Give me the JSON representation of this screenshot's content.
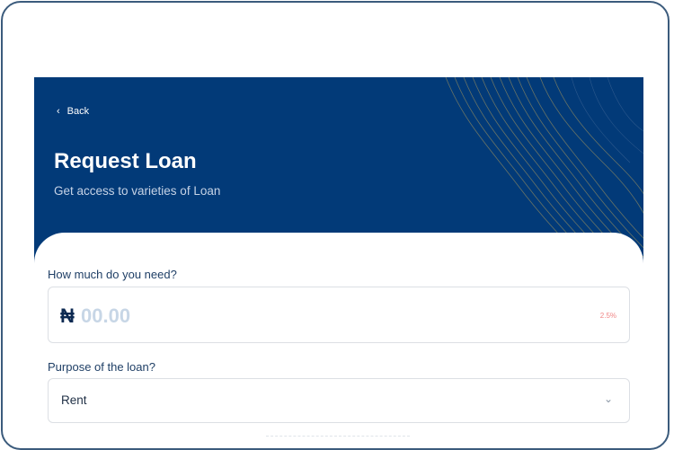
{
  "header": {
    "back_label": "Back",
    "title": "Request Loan",
    "subtitle": "Get access to varieties of Loan",
    "bg_color": "#023a78"
  },
  "form": {
    "amount_label": "How much do you need?",
    "currency_symbol": "₦",
    "amount_placeholder": "00.00",
    "rate": "2.5%",
    "purpose_label": "Purpose of the loan?",
    "purpose_value": "Rent"
  },
  "icons": {
    "back": "chevron-left-icon",
    "dropdown": "chevron-down-icon"
  }
}
